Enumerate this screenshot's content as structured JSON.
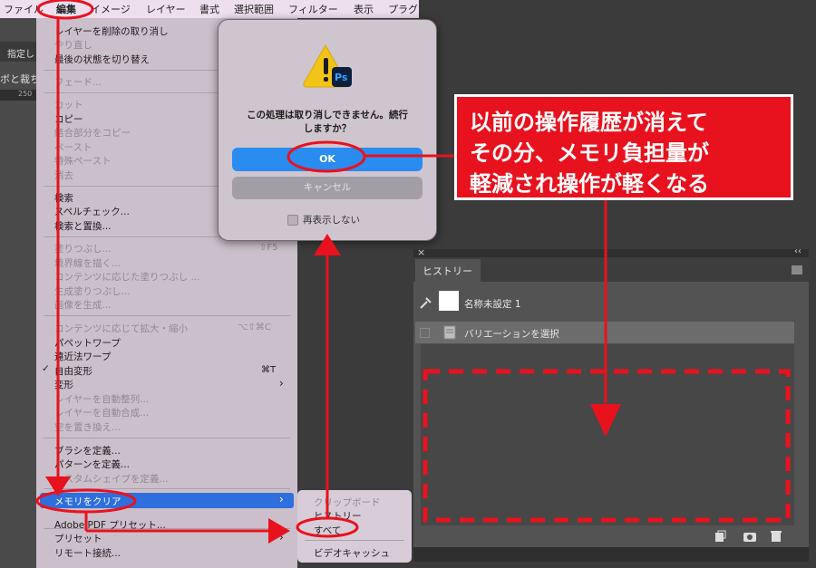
{
  "menubar": {
    "items": [
      "ファイル",
      "編集",
      "イメージ",
      "レイヤー",
      "書式",
      "選択範囲",
      "フィルター",
      "表示",
      "プラグ"
    ]
  },
  "background": {
    "tool_label": "指定し",
    "panel_label": "ボと裁ち",
    "ruler_mark": "250"
  },
  "edit_menu": {
    "items": [
      {
        "label": "レイヤーを削除の取り消し",
        "shortcut": ""
      },
      {
        "label": "やり直し",
        "shortcut": ""
      },
      {
        "label": "最後の状態を切り替え",
        "shortcut": ""
      },
      {
        "label": "フェード...",
        "shortcut": ""
      },
      {
        "label": "カット",
        "shortcut": ""
      },
      {
        "label": "コピー",
        "shortcut": ""
      },
      {
        "label": "結合部分をコピー",
        "shortcut": ""
      },
      {
        "label": "ペースト",
        "shortcut": ""
      },
      {
        "label": "特殊ペースト",
        "shortcut": ""
      },
      {
        "label": "消去",
        "shortcut": ""
      },
      {
        "label": "検索",
        "shortcut": ""
      },
      {
        "label": "スペルチェック...",
        "shortcut": ""
      },
      {
        "label": "検索と置換...",
        "shortcut": ""
      },
      {
        "label": "塗りつぶし...",
        "shortcut": "⇧F5"
      },
      {
        "label": "境界線を描く...",
        "shortcut": ""
      },
      {
        "label": "コンテンツに応じた塗りつぶし ...",
        "shortcut": ""
      },
      {
        "label": "生成塗りつぶし...",
        "shortcut": ""
      },
      {
        "label": "画像を生成...",
        "shortcut": ""
      },
      {
        "label": "コンテンツに応じて拡大・縮小",
        "shortcut": "⌥⇧⌘C"
      },
      {
        "label": "パペットワープ",
        "shortcut": ""
      },
      {
        "label": "遠近法ワープ",
        "shortcut": ""
      },
      {
        "label": "自由変形",
        "shortcut": "⌘T"
      },
      {
        "label": "変形",
        "shortcut": "›"
      },
      {
        "label": "レイヤーを自動整列...",
        "shortcut": ""
      },
      {
        "label": "レイヤーを自動合成...",
        "shortcut": ""
      },
      {
        "label": "空を置き換え...",
        "shortcut": ""
      },
      {
        "label": "ブラシを定義...",
        "shortcut": ""
      },
      {
        "label": "パターンを定義...",
        "shortcut": ""
      },
      {
        "label": "カスタムシェイプを定義...",
        "shortcut": ""
      },
      {
        "label": "メモリをクリア",
        "shortcut": "›"
      },
      {
        "label": "Adobe PDF プリセット...",
        "shortcut": ""
      },
      {
        "label": "プリセット",
        "shortcut": "›"
      },
      {
        "label": "リモート接続...",
        "shortcut": ""
      }
    ],
    "checkmark": "✓"
  },
  "submenu": {
    "items": [
      "クリップボード",
      "ヒストリー",
      "すべて",
      "ビデオキャッシュ"
    ]
  },
  "dialog": {
    "app_badge": "Ps",
    "message_line1": "この処理は取り消しできません。続行",
    "message_line2": "しますか？",
    "ok_label": "OK",
    "cancel_label": "キャンセル",
    "dont_show_label": "再表示しない"
  },
  "callout": {
    "line1": "以前の操作履歴が消えて",
    "line2": "その分、メモリ負担量が",
    "line3": "軽減され操作が軽くなる"
  },
  "history_panel": {
    "tab_label": "ヒストリー",
    "snapshot_label": "名称未設定 1",
    "step_label": "バリエーションを選択",
    "close_glyph": "×",
    "collapse_glyph": "‹‹"
  },
  "colors": {
    "annotation_red": "#e8121e",
    "menu_highlight": "#2f6fdd",
    "ok_button": "#2a8bf0"
  }
}
